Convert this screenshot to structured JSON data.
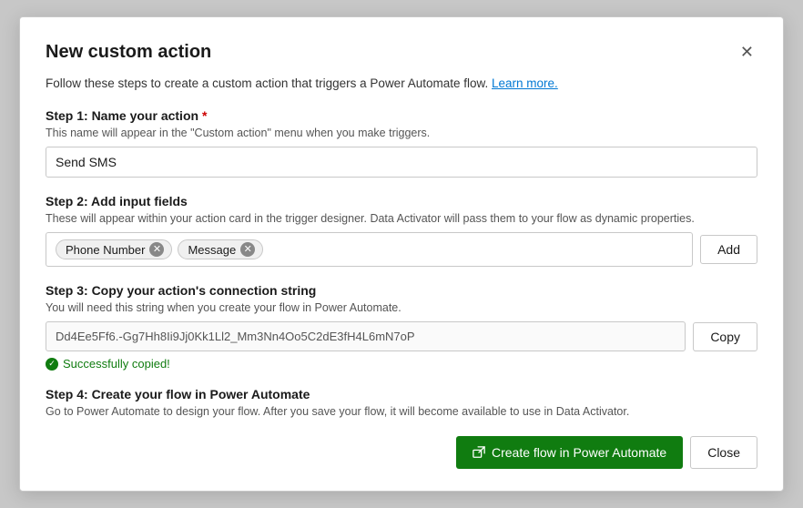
{
  "modal": {
    "title": "New custom action",
    "close_label": "✕",
    "intro_text": "Follow these steps to create a custom action that triggers a Power Automate flow.",
    "learn_more_label": "Learn more.",
    "learn_more_url": "#",
    "step1": {
      "title": "Step 1: Name your action",
      "required": "*",
      "description": "This name will appear in the \"Custom action\" menu when you make triggers.",
      "input_value": "Send SMS",
      "input_placeholder": "Send SMS"
    },
    "step2": {
      "title": "Step 2: Add input fields",
      "description": "These will appear within your action card in the trigger designer. Data Activator will pass them to your flow as dynamic properties.",
      "tags": [
        {
          "label": "Phone Number"
        },
        {
          "label": "Message"
        }
      ],
      "add_button_label": "Add"
    },
    "step3": {
      "title": "Step 3: Copy your action's connection string",
      "description": "You will need this string when you create your flow in Power Automate.",
      "connection_string": "Dd4Ee5Ff6.-Gg7Hh8Ii9Jj0Kk1Ll2_Mm3Nn4Oo5C2dE3fH4L6mN7oP",
      "copy_button_label": "Copy",
      "success_text": "Successfully copied!"
    },
    "step4": {
      "title": "Step 4: Create your flow in Power Automate",
      "description": "Go to Power Automate to design your flow. After you save your flow, it will become available to use in Data Activator."
    },
    "footer": {
      "create_button_label": "Create flow in Power Automate",
      "close_button_label": "Close"
    }
  }
}
